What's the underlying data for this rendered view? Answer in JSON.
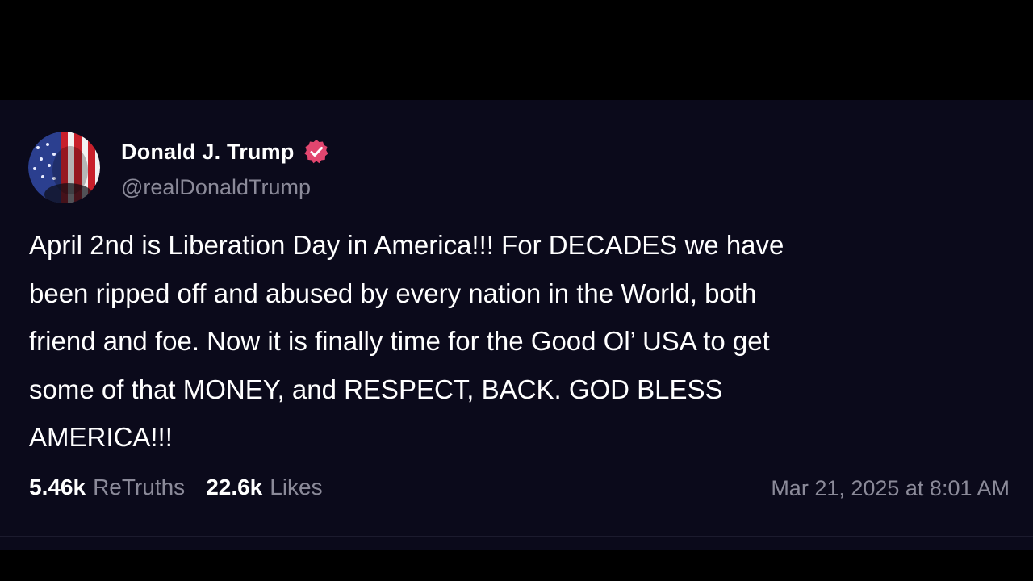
{
  "post": {
    "author": {
      "display_name": "Donald J. Trump",
      "handle": "@realDonaldTrump",
      "verified": true,
      "avatar_icon": "flag-portrait-avatar",
      "verified_icon": "verified-check-icon"
    },
    "text_lines": [
      "April 2nd is Liberation Day in America!!! For DECADES we have",
      "been ripped off and abused by every nation in the World, both",
      "friend and foe. Now it is finally time for the Good Ol’ USA to get",
      "some of that MONEY, and RESPECT, BACK. GOD BLESS",
      "AMERICA!!!"
    ],
    "stats": {
      "retruths_count": "5.46k",
      "retruths_label": "ReTruths",
      "likes_count": "22.6k",
      "likes_label": "Likes"
    },
    "timestamp": "Mar 21, 2025 at 8:01 AM"
  },
  "colors": {
    "background": "#000000",
    "card_background": "#0b0a1b",
    "primary_text": "#ffffff",
    "secondary_text": "#8b8a99",
    "verified_badge": "#e2466f"
  }
}
